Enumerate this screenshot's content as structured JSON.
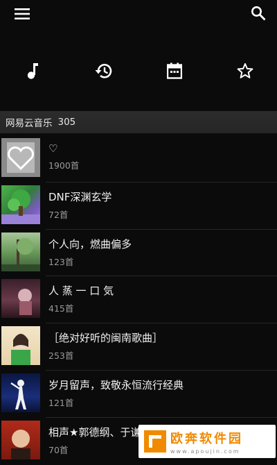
{
  "topbar": {
    "menu_icon": "hamburger-menu-icon",
    "search_icon": "search-icon"
  },
  "tabs": [
    {
      "icon": "music-note-icon"
    },
    {
      "icon": "history-icon"
    },
    {
      "icon": "calendar-icon"
    },
    {
      "icon": "star-icon"
    }
  ],
  "section": {
    "title": "网易云音乐",
    "count": "305"
  },
  "playlists": [
    {
      "title": "♡",
      "count": "1900首"
    },
    {
      "title": "DNF深渊玄学",
      "count": "72首"
    },
    {
      "title": "个人向，燃曲偏多",
      "count": "123首"
    },
    {
      "title": "人 蒸 一 口 気",
      "count": "415首"
    },
    {
      "title": "［绝对好听的闽南歌曲］",
      "count": "253首"
    },
    {
      "title": "岁月留声，致敬永恒流行经典",
      "count": "121首"
    },
    {
      "title": "相声★郭德纲、于谦",
      "count": "70首"
    }
  ],
  "watermark": {
    "name": "欧奔软件园",
    "url": "www.apoujin.com"
  },
  "colors": {
    "background": "#0b0b0b",
    "header": "#2c2c2c",
    "accent": "#f08a00"
  }
}
